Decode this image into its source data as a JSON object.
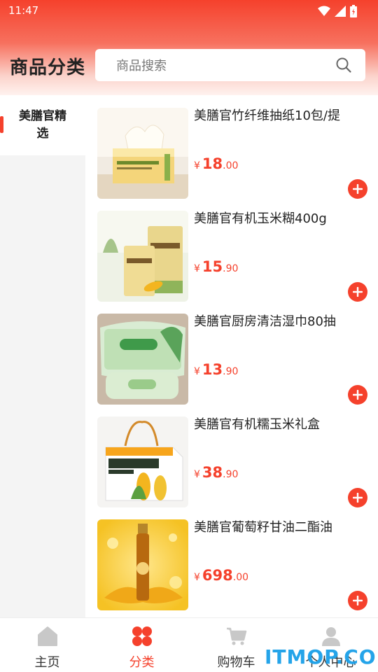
{
  "status_bar": {
    "time": "11:47"
  },
  "header": {
    "title": "商品分类"
  },
  "search": {
    "placeholder": "商品搜索"
  },
  "sidebar": {
    "categories": [
      {
        "label": "美膳官精选",
        "selected": true
      }
    ]
  },
  "products": [
    {
      "name": "美膳官竹纤维抽纸10包/提",
      "currency": "¥",
      "price_int": "18",
      "price_dec": ".00",
      "image": "tissue-box"
    },
    {
      "name": "美膳官有机玉米糊400g",
      "currency": "¥",
      "price_int": "15",
      "price_dec": ".90",
      "image": "corn-porridge-bags"
    },
    {
      "name": "美膳官厨房清洁湿巾80抽",
      "currency": "¥",
      "price_int": "13",
      "price_dec": ".90",
      "image": "kitchen-wipes"
    },
    {
      "name": "美膳官有机糯玉米礼盒",
      "currency": "¥",
      "price_int": "38",
      "price_dec": ".90",
      "image": "corn-gift-box"
    },
    {
      "name": "美膳官葡萄籽甘油二酯油",
      "currency": "¥",
      "price_int": "698",
      "price_dec": ".00",
      "image": "grapeseed-oil-bottle"
    }
  ],
  "tabbar": {
    "tabs": [
      {
        "label": "主页",
        "icon": "home-icon",
        "active": false
      },
      {
        "label": "分类",
        "icon": "category-icon",
        "active": true
      },
      {
        "label": "购物车",
        "icon": "cart-icon",
        "active": false
      },
      {
        "label": "个人中心",
        "icon": "user-icon",
        "active": false
      }
    ]
  },
  "colors": {
    "accent": "#f5412c",
    "inactive_icon": "#c8c8c8"
  },
  "watermark": {
    "text": "ITMOP.COM"
  }
}
